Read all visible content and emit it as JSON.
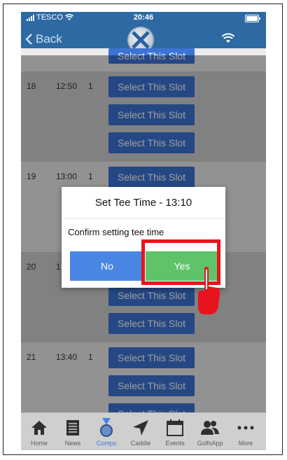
{
  "status_bar": {
    "carrier": "TESCO",
    "time": "20:46"
  },
  "nav": {
    "back_label": "Back"
  },
  "slot_button_label": "Select This Slot",
  "rows": [
    {
      "number": "18",
      "time": "12:50",
      "count": "1"
    },
    {
      "number": "19",
      "time": "13:00",
      "count": "1"
    },
    {
      "number": "20",
      "time": "1",
      "count": ""
    },
    {
      "number": "21",
      "time": "13:40",
      "count": "1"
    }
  ],
  "dialog": {
    "title": "Set Tee Time - 13:10",
    "message": "Confirm setting tee time",
    "no_label": "No",
    "yes_label": "Yes"
  },
  "tabs": [
    {
      "label": "Home",
      "icon": "home-icon"
    },
    {
      "label": "News",
      "icon": "news-icon"
    },
    {
      "label": "Comps",
      "icon": "medal-icon",
      "active": true
    },
    {
      "label": "Caddie",
      "icon": "location-arrow-icon"
    },
    {
      "label": "Events",
      "icon": "calendar-icon"
    },
    {
      "label": "GolfsApp",
      "icon": "people-icon"
    },
    {
      "label": "More",
      "icon": "more-dots-icon"
    }
  ],
  "colors": {
    "nav": "#2d6aa3",
    "slot_button": "#3c74d6",
    "no_button": "#4a86e4",
    "yes_button": "#5fc36a",
    "highlight": "#e8141d"
  }
}
